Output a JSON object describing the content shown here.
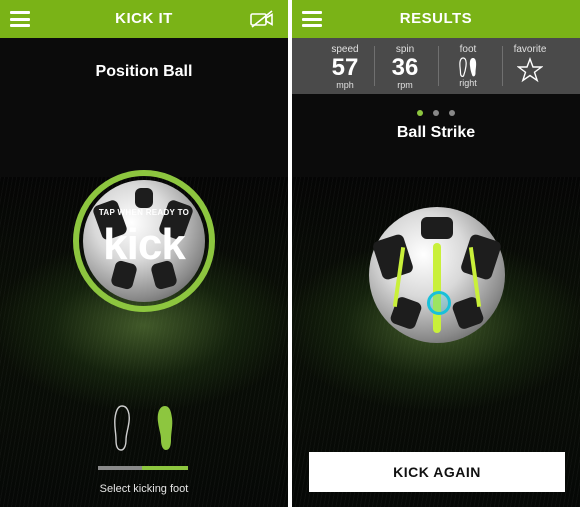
{
  "left_screen": {
    "header": {
      "title": "KICK IT"
    },
    "screen_title": "Position Ball",
    "tap_prompt": "TAP WHEN READY TO",
    "action_word": "kick",
    "footer_caption": "Select kicking foot",
    "selected_foot": "right"
  },
  "right_screen": {
    "header": {
      "title": "RESULTS"
    },
    "stats": [
      {
        "label": "speed",
        "value": "57",
        "unit": "mph"
      },
      {
        "label": "spin",
        "value": "36",
        "unit": "rpm"
      },
      {
        "label": "foot",
        "value": "",
        "unit": "right"
      },
      {
        "label": "favorite",
        "value": "",
        "unit": ""
      }
    ],
    "pager": {
      "count": 3,
      "active": 1
    },
    "screen_title": "Ball Strike",
    "kick_again_label": "KICK AGAIN"
  },
  "colors": {
    "accent": "#7ab317",
    "accent_ring": "#8dc63f",
    "stripe": "#c9f03a",
    "stats_bg": "#4a4a4a"
  },
  "icons": [
    "menu-icon",
    "camera-off-icon",
    "foot-outline-icon",
    "foot-filled-icon",
    "star-icon",
    "feet-icon"
  ]
}
